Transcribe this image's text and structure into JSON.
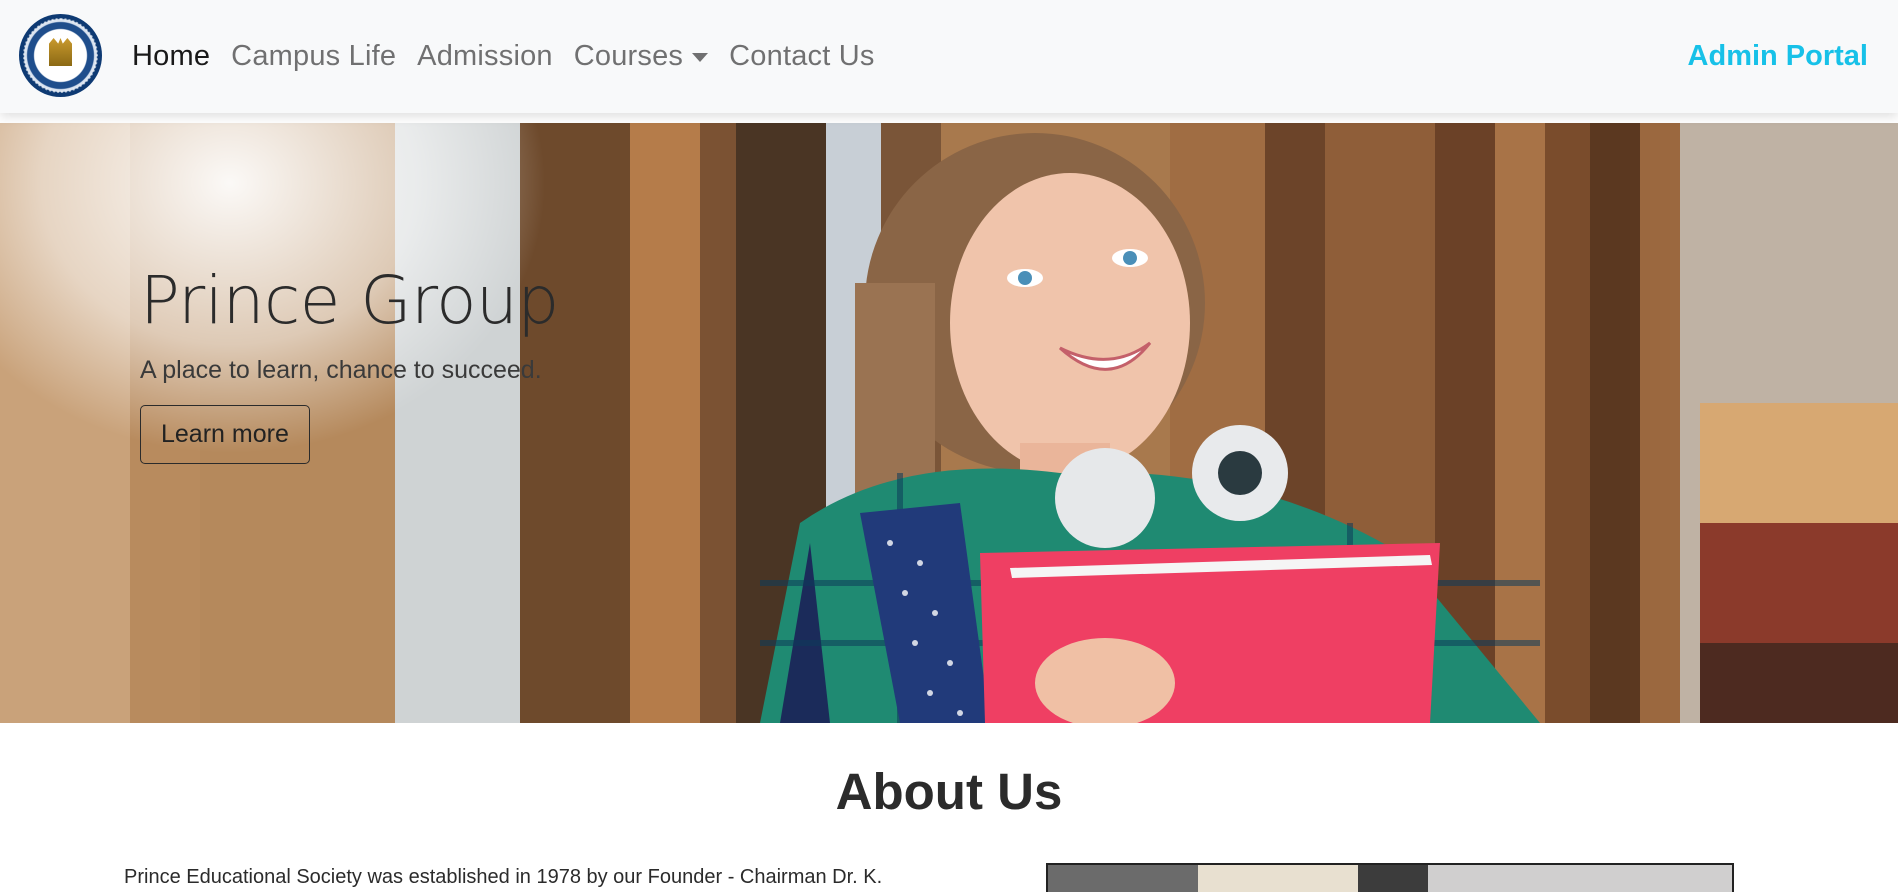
{
  "navbar": {
    "logo_alt": "Prince Educational Society emblem",
    "links": [
      {
        "label": "Home",
        "active": true
      },
      {
        "label": "Campus Life",
        "active": false
      },
      {
        "label": "Admission",
        "active": false
      },
      {
        "label": "Courses",
        "active": false,
        "dropdown": true
      },
      {
        "label": "Contact Us",
        "active": false
      }
    ],
    "admin_link": "Admin Portal"
  },
  "hero": {
    "title": "Prince Group",
    "subtitle": "A place to learn, chance to succeed.",
    "button_label": "Learn more"
  },
  "about": {
    "title": "About Us",
    "text": "Prince Educational Society was established in 1978 by our Founder - Chairman Dr. K."
  },
  "colors": {
    "navbar_bg": "#f8f9fa",
    "admin_accent": "#17c1e8",
    "text_dark": "#212529"
  },
  "icons": {
    "courses_caret": "caret-down-icon"
  }
}
